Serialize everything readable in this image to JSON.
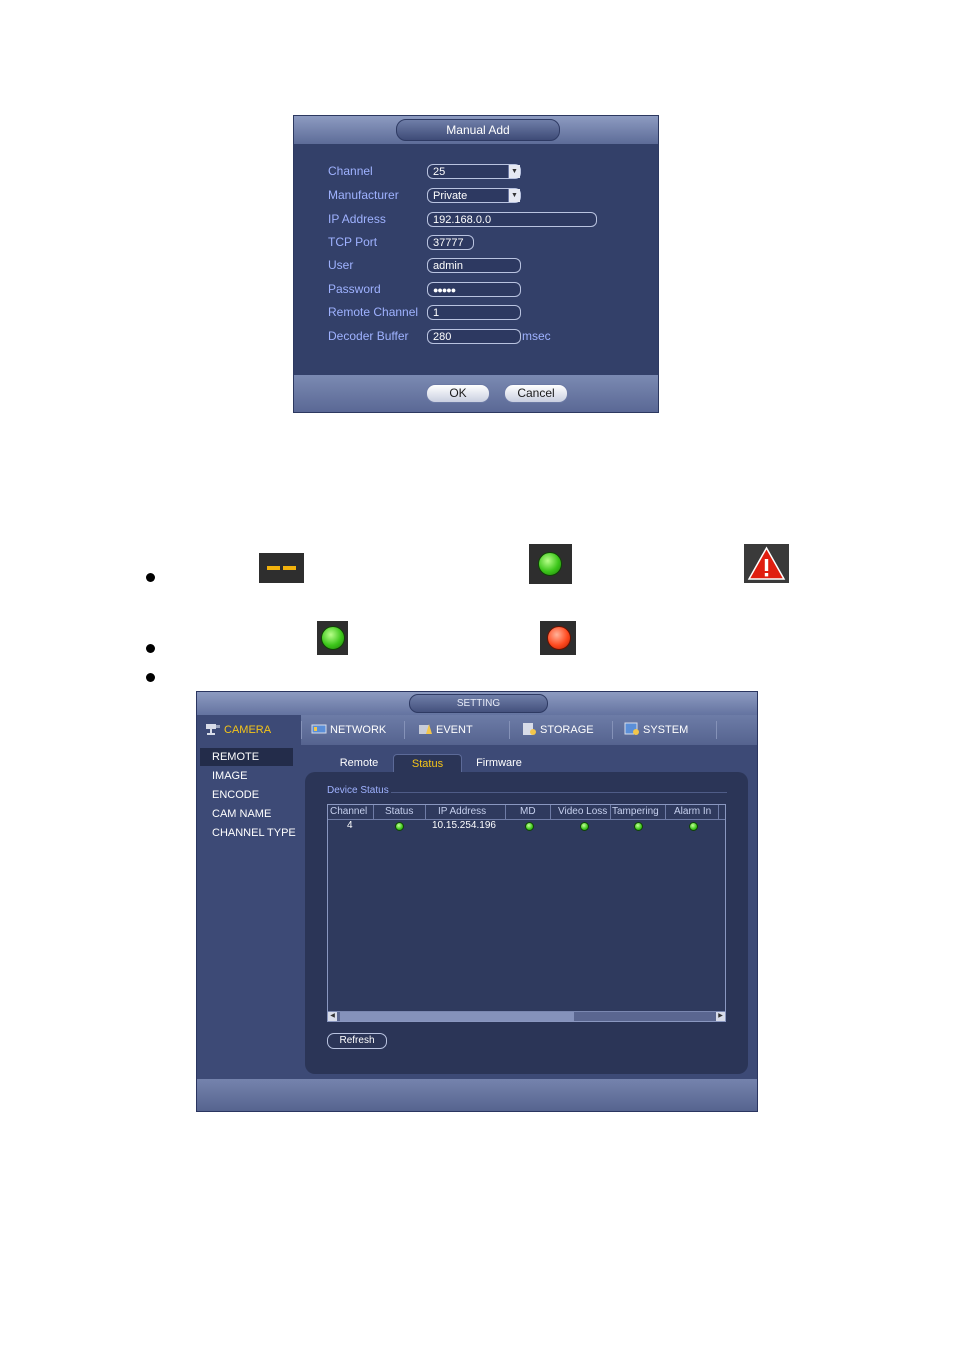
{
  "manual_add": {
    "title": "Manual Add",
    "fields": {
      "channel": {
        "label": "Channel",
        "value": "25"
      },
      "manufacturer": {
        "label": "Manufacturer",
        "value": "Private"
      },
      "ip_address": {
        "label": "IP Address",
        "value": "192.168.0.0"
      },
      "tcp_port": {
        "label": "TCP Port",
        "value": "37777"
      },
      "user": {
        "label": "User",
        "value": "admin"
      },
      "password": {
        "label": "Password",
        "value": "●●●●●"
      },
      "remote_channel": {
        "label": "Remote Channel",
        "value": "1"
      },
      "decoder_buffer": {
        "label": "Decoder Buffer",
        "value": "280",
        "unit": "msec"
      }
    },
    "ok_label": "OK",
    "cancel_label": "Cancel"
  },
  "colors": {
    "dialog_bg": "#334069",
    "label_blue": "#9fb2ff",
    "accent_yellow": "#f5c518",
    "status_green": "#3cc61a",
    "status_red": "#ff4a1f",
    "dash_yellow": "#f2b20c",
    "warning_red": "#e01e10"
  },
  "icons": [
    "disconnected-dash-icon",
    "connected-green-icon",
    "warning-triangle-icon",
    "status-green-icon",
    "status-red-icon"
  ],
  "setting": {
    "title": "SETTING",
    "tabs": [
      {
        "label": "CAMERA",
        "icon": "camera-icon"
      },
      {
        "label": "NETWORK",
        "icon": "network-icon"
      },
      {
        "label": "EVENT",
        "icon": "event-icon"
      },
      {
        "label": "STORAGE",
        "icon": "storage-icon"
      },
      {
        "label": "SYSTEM",
        "icon": "system-icon"
      }
    ],
    "sidebar": [
      "REMOTE",
      "IMAGE",
      "ENCODE",
      "CAM NAME",
      "CHANNEL TYPE"
    ],
    "subtabs": [
      "Remote",
      "Status",
      "Firmware"
    ],
    "section_label": "Device Status",
    "columns": [
      "Channel",
      "Status",
      "IP Address",
      "MD",
      "Video Loss",
      "Tampering",
      "Alarm In"
    ],
    "rows": [
      {
        "channel": "4",
        "ip": "10.15.254.196"
      }
    ],
    "refresh_label": "Refresh"
  }
}
